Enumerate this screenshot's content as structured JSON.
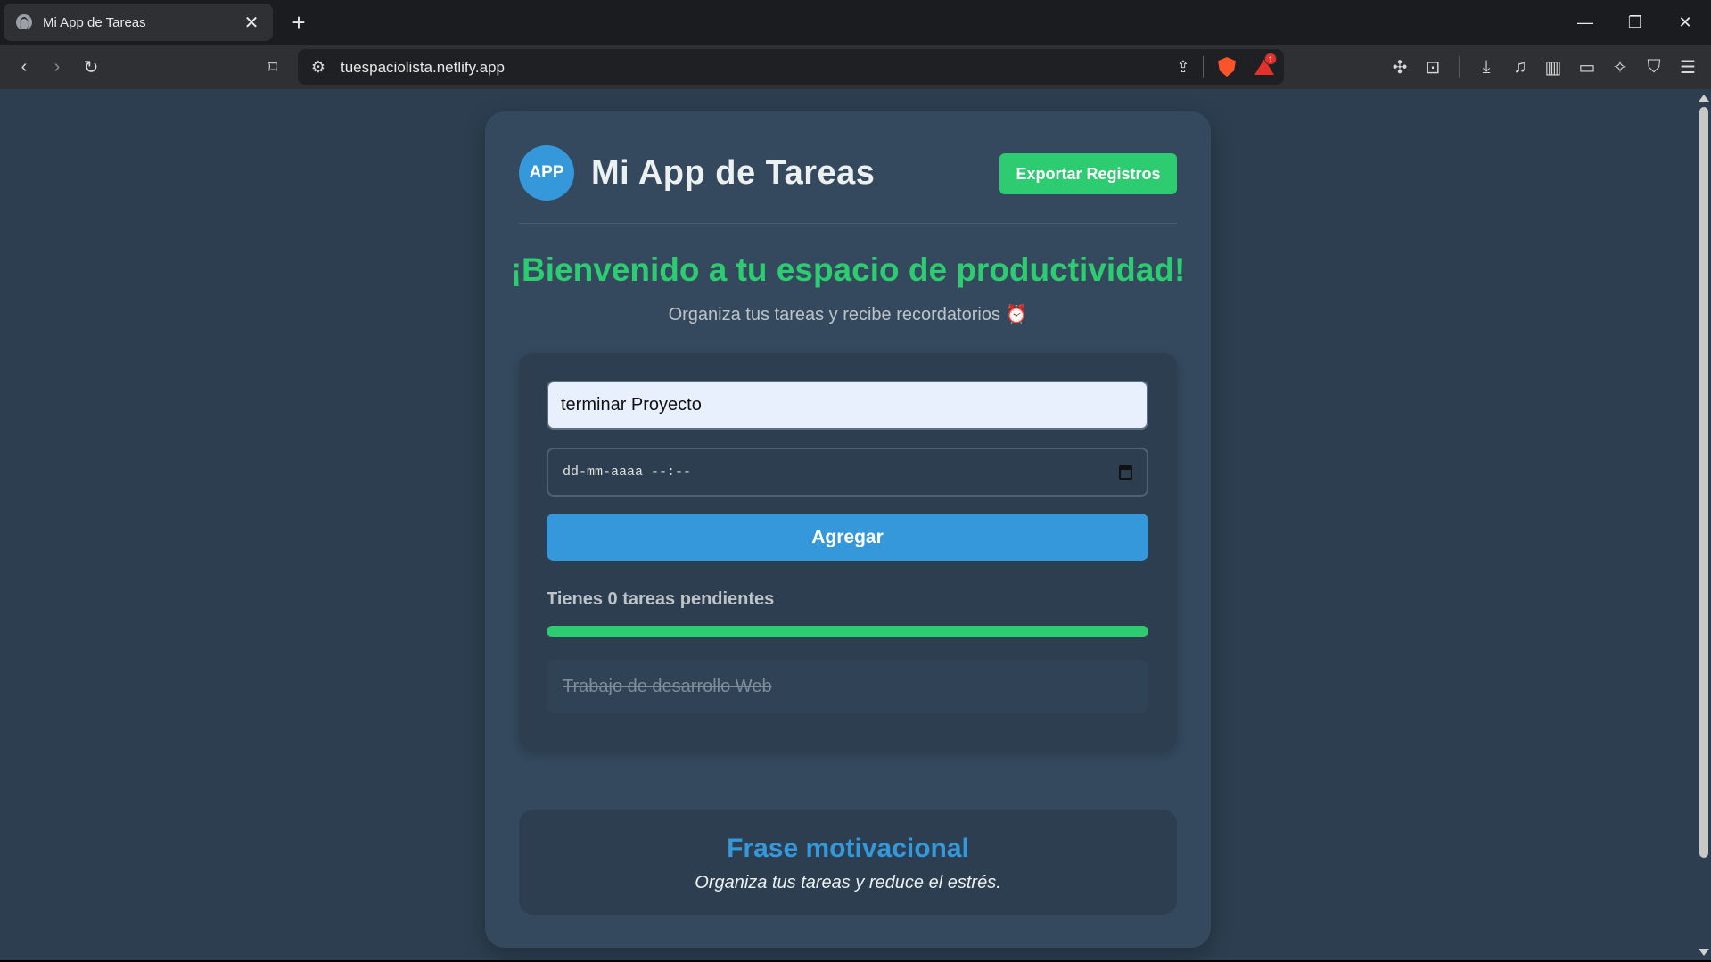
{
  "browser": {
    "tab_title": "Mi App de Tareas",
    "close_glyph": "✕",
    "newtab_glyph": "+",
    "url": "tuespaciolista.netlify.app",
    "notification_count": "1"
  },
  "app": {
    "logo_text": "APP",
    "title": "Mi App de Tareas",
    "export_label": "Exportar Registros",
    "welcome": "¡Bienvenido a tu espacio de productividad!",
    "subtitle": "Organiza tus tareas y recibe recordatorios ⏰",
    "task_input_value": "terminar Proyecto",
    "date_placeholder": "dd-mm-aaaa --:--",
    "add_label": "Agregar",
    "pending_text": "Tienes 0 tareas pendientes",
    "progress_percent": 100,
    "tasks": [
      {
        "text": "Trabajo de desarrollo Web",
        "completed": true
      }
    ],
    "quote_title": "Frase motivacional",
    "quote_text": "Organiza tus tareas y reduce el estrés."
  },
  "colors": {
    "accent_green": "#2ecc71",
    "accent_blue": "#3498db",
    "background": "#2c3e50",
    "card": "#34495e"
  }
}
